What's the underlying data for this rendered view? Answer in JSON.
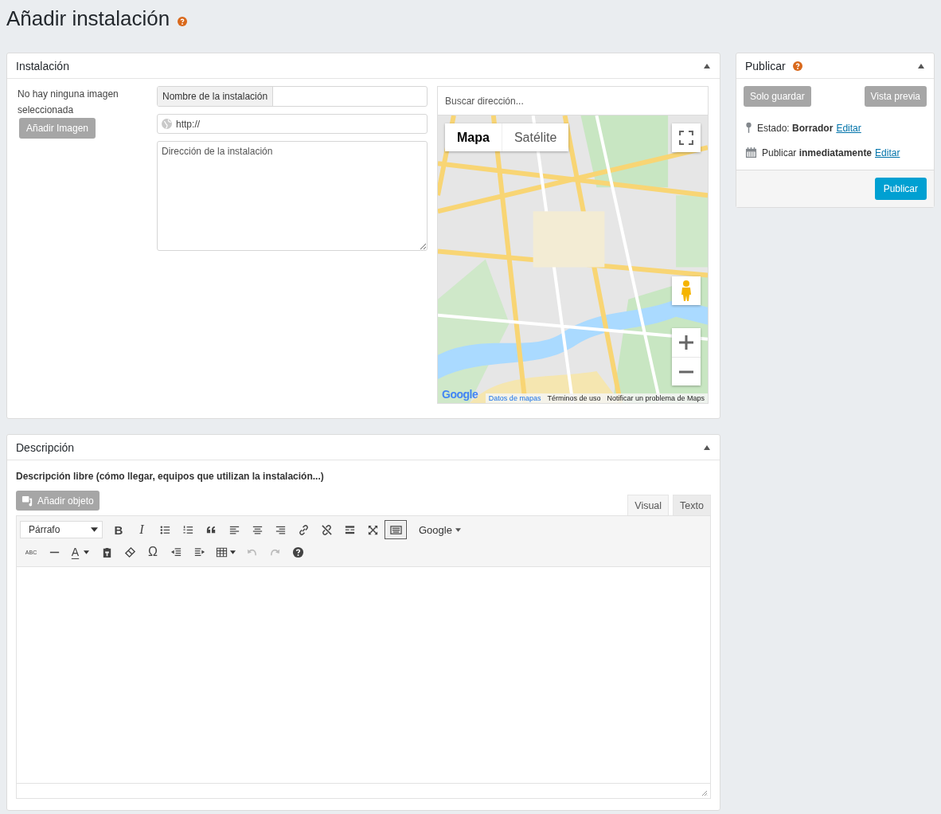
{
  "page_title": "Añadir instalación",
  "installation": {
    "title": "Instalación",
    "expanded": true,
    "image_note": "No hay ninguna imagen seleccionada",
    "add_image_button": {
      "label": "Añadir Imagen",
      "disabled": true
    },
    "name_label": "Nombre de la instalación",
    "url_placeholder": "http://",
    "address_placeholder": "Dirección de la instalación",
    "map": {
      "search_placeholder": "Buscar dirección...",
      "map_types": [
        {
          "label": "Mapa",
          "selected": true
        },
        {
          "label": "Satélite",
          "selected": false
        }
      ],
      "logo": "Google",
      "footer_links": [
        "Datos de mapas",
        "Términos de uso",
        "Notificar un problema de Maps"
      ]
    }
  },
  "publish": {
    "title": "Publicar",
    "expanded": true,
    "buttons": [
      {
        "label": "Solo guardar",
        "disabled": true
      },
      {
        "label": "Vista previa",
        "disabled": true
      }
    ],
    "rows": [
      {
        "kind": "status",
        "text": "Estado: **Borrador**",
        "link": "Editar"
      },
      {
        "kind": "schedule",
        "text": "Publicar **inmediatamente**",
        "link": "Editar"
      }
    ],
    "publish_button": "Publicar"
  },
  "description": {
    "title": "Descripción",
    "expanded": true,
    "label": "Descripción libre (cómo llegar, equipos que utilizan la instalación...)",
    "add_object_button": {
      "label": "Añadir objeto",
      "disabled": true
    },
    "editor_tabs": [
      {
        "label": "Visual",
        "selected": true
      },
      {
        "label": "Texto",
        "selected": false
      }
    ],
    "format_select": "Párrafo",
    "font_menu": "Google",
    "toolbar_rows": [
      [
        {
          "kind": "bold",
          "label": "B",
          "active": false,
          "disabled": false
        },
        {
          "kind": "italic",
          "label": "I",
          "active": false,
          "disabled": false
        },
        {
          "kind": "bullets",
          "active": false,
          "disabled": false
        },
        {
          "kind": "numbers",
          "active": false,
          "disabled": false
        },
        {
          "kind": "quote",
          "active": false,
          "disabled": false
        },
        {
          "kind": "align-left",
          "active": false,
          "disabled": false
        },
        {
          "kind": "align-center",
          "active": false,
          "disabled": false
        },
        {
          "kind": "align-right",
          "active": false,
          "disabled": false
        },
        {
          "kind": "link",
          "active": false,
          "disabled": false
        },
        {
          "kind": "unlink",
          "active": false,
          "disabled": false
        },
        {
          "kind": "more",
          "active": false,
          "disabled": false
        },
        {
          "kind": "fullscreen",
          "active": false,
          "disabled": false
        },
        {
          "kind": "keyboard",
          "active": true,
          "disabled": false
        }
      ],
      [
        {
          "kind": "strike",
          "label": "ABC",
          "active": false,
          "disabled": false
        },
        {
          "kind": "hr",
          "active": false,
          "disabled": false
        },
        {
          "kind": "color",
          "label": "A",
          "active": false,
          "disabled": false
        },
        {
          "kind": "paste",
          "active": false,
          "disabled": false
        },
        {
          "kind": "eraser",
          "active": false,
          "disabled": false
        },
        {
          "kind": "char",
          "label": "Ω",
          "active": false,
          "disabled": false
        },
        {
          "kind": "outdent",
          "active": false,
          "disabled": false
        },
        {
          "kind": "indent",
          "active": false,
          "disabled": false
        },
        {
          "kind": "table",
          "active": false,
          "disabled": false
        },
        {
          "kind": "undo",
          "active": false,
          "disabled": true
        },
        {
          "kind": "redo",
          "active": false,
          "disabled": true
        },
        {
          "kind": "help",
          "active": false,
          "disabled": false
        }
      ]
    ]
  }
}
